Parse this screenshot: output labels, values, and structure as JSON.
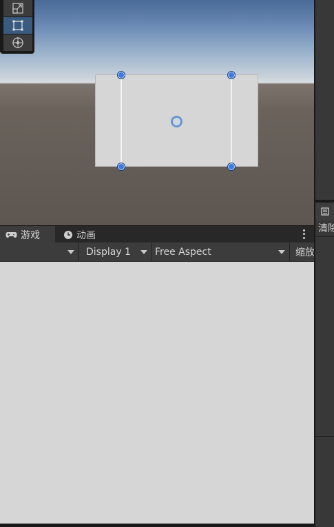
{
  "game_panel": {
    "tabs": [
      {
        "label": "游戏",
        "icon": "gamepad-icon",
        "active": true
      },
      {
        "label": "动画",
        "icon": "clock-icon",
        "active": false
      }
    ],
    "toolbar": {
      "display": "Display 1",
      "aspect": "Free Aspect",
      "scale_label": "缩放"
    }
  },
  "right_panel": {
    "clear_label": "清除"
  },
  "colors": {
    "accent": "#3b7be0",
    "panel": "#3c3c3c",
    "game_bg": "#d6d6d6"
  }
}
